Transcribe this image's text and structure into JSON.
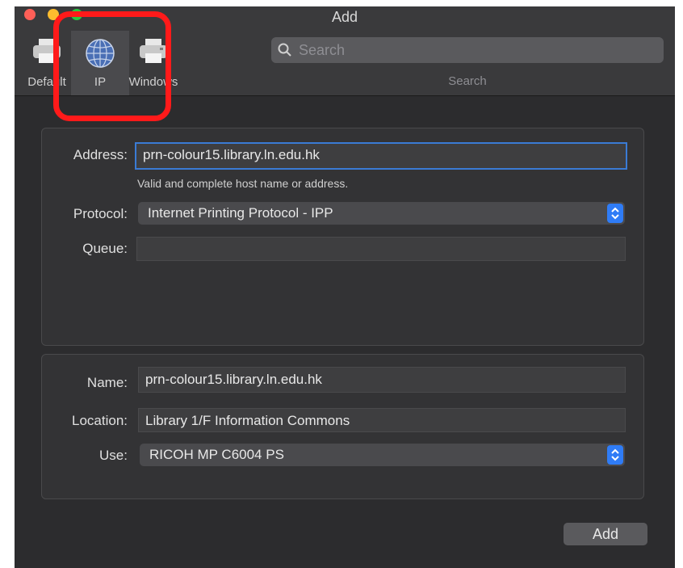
{
  "window": {
    "title": "Add"
  },
  "toolbar": {
    "items": [
      {
        "label": "Default",
        "icon": "printer-icon"
      },
      {
        "label": "IP",
        "icon": "globe-icon"
      },
      {
        "label": "Windows",
        "icon": "printer-icon"
      }
    ],
    "selected": "IP"
  },
  "search": {
    "placeholder": "Search",
    "label": "Search"
  },
  "ip_group": {
    "address_label": "Address:",
    "address_value": "prn-colour15.library.ln.edu.hk",
    "address_hint": "Valid and complete host name or address.",
    "protocol_label": "Protocol:",
    "protocol_value": "Internet Printing Protocol - IPP",
    "queue_label": "Queue:",
    "queue_value": ""
  },
  "printer_group": {
    "name_label": "Name:",
    "name_value": "prn-colour15.library.ln.edu.hk",
    "location_label": "Location:",
    "location_value": "Library 1/F Information Commons",
    "use_label": "Use:",
    "use_value": "RICOH MP C6004 PS"
  },
  "footer": {
    "add_label": "Add"
  },
  "colors": {
    "highlight": "#ff1a1a",
    "accent": "#2f7cf6",
    "focus": "#3a7bd5"
  }
}
